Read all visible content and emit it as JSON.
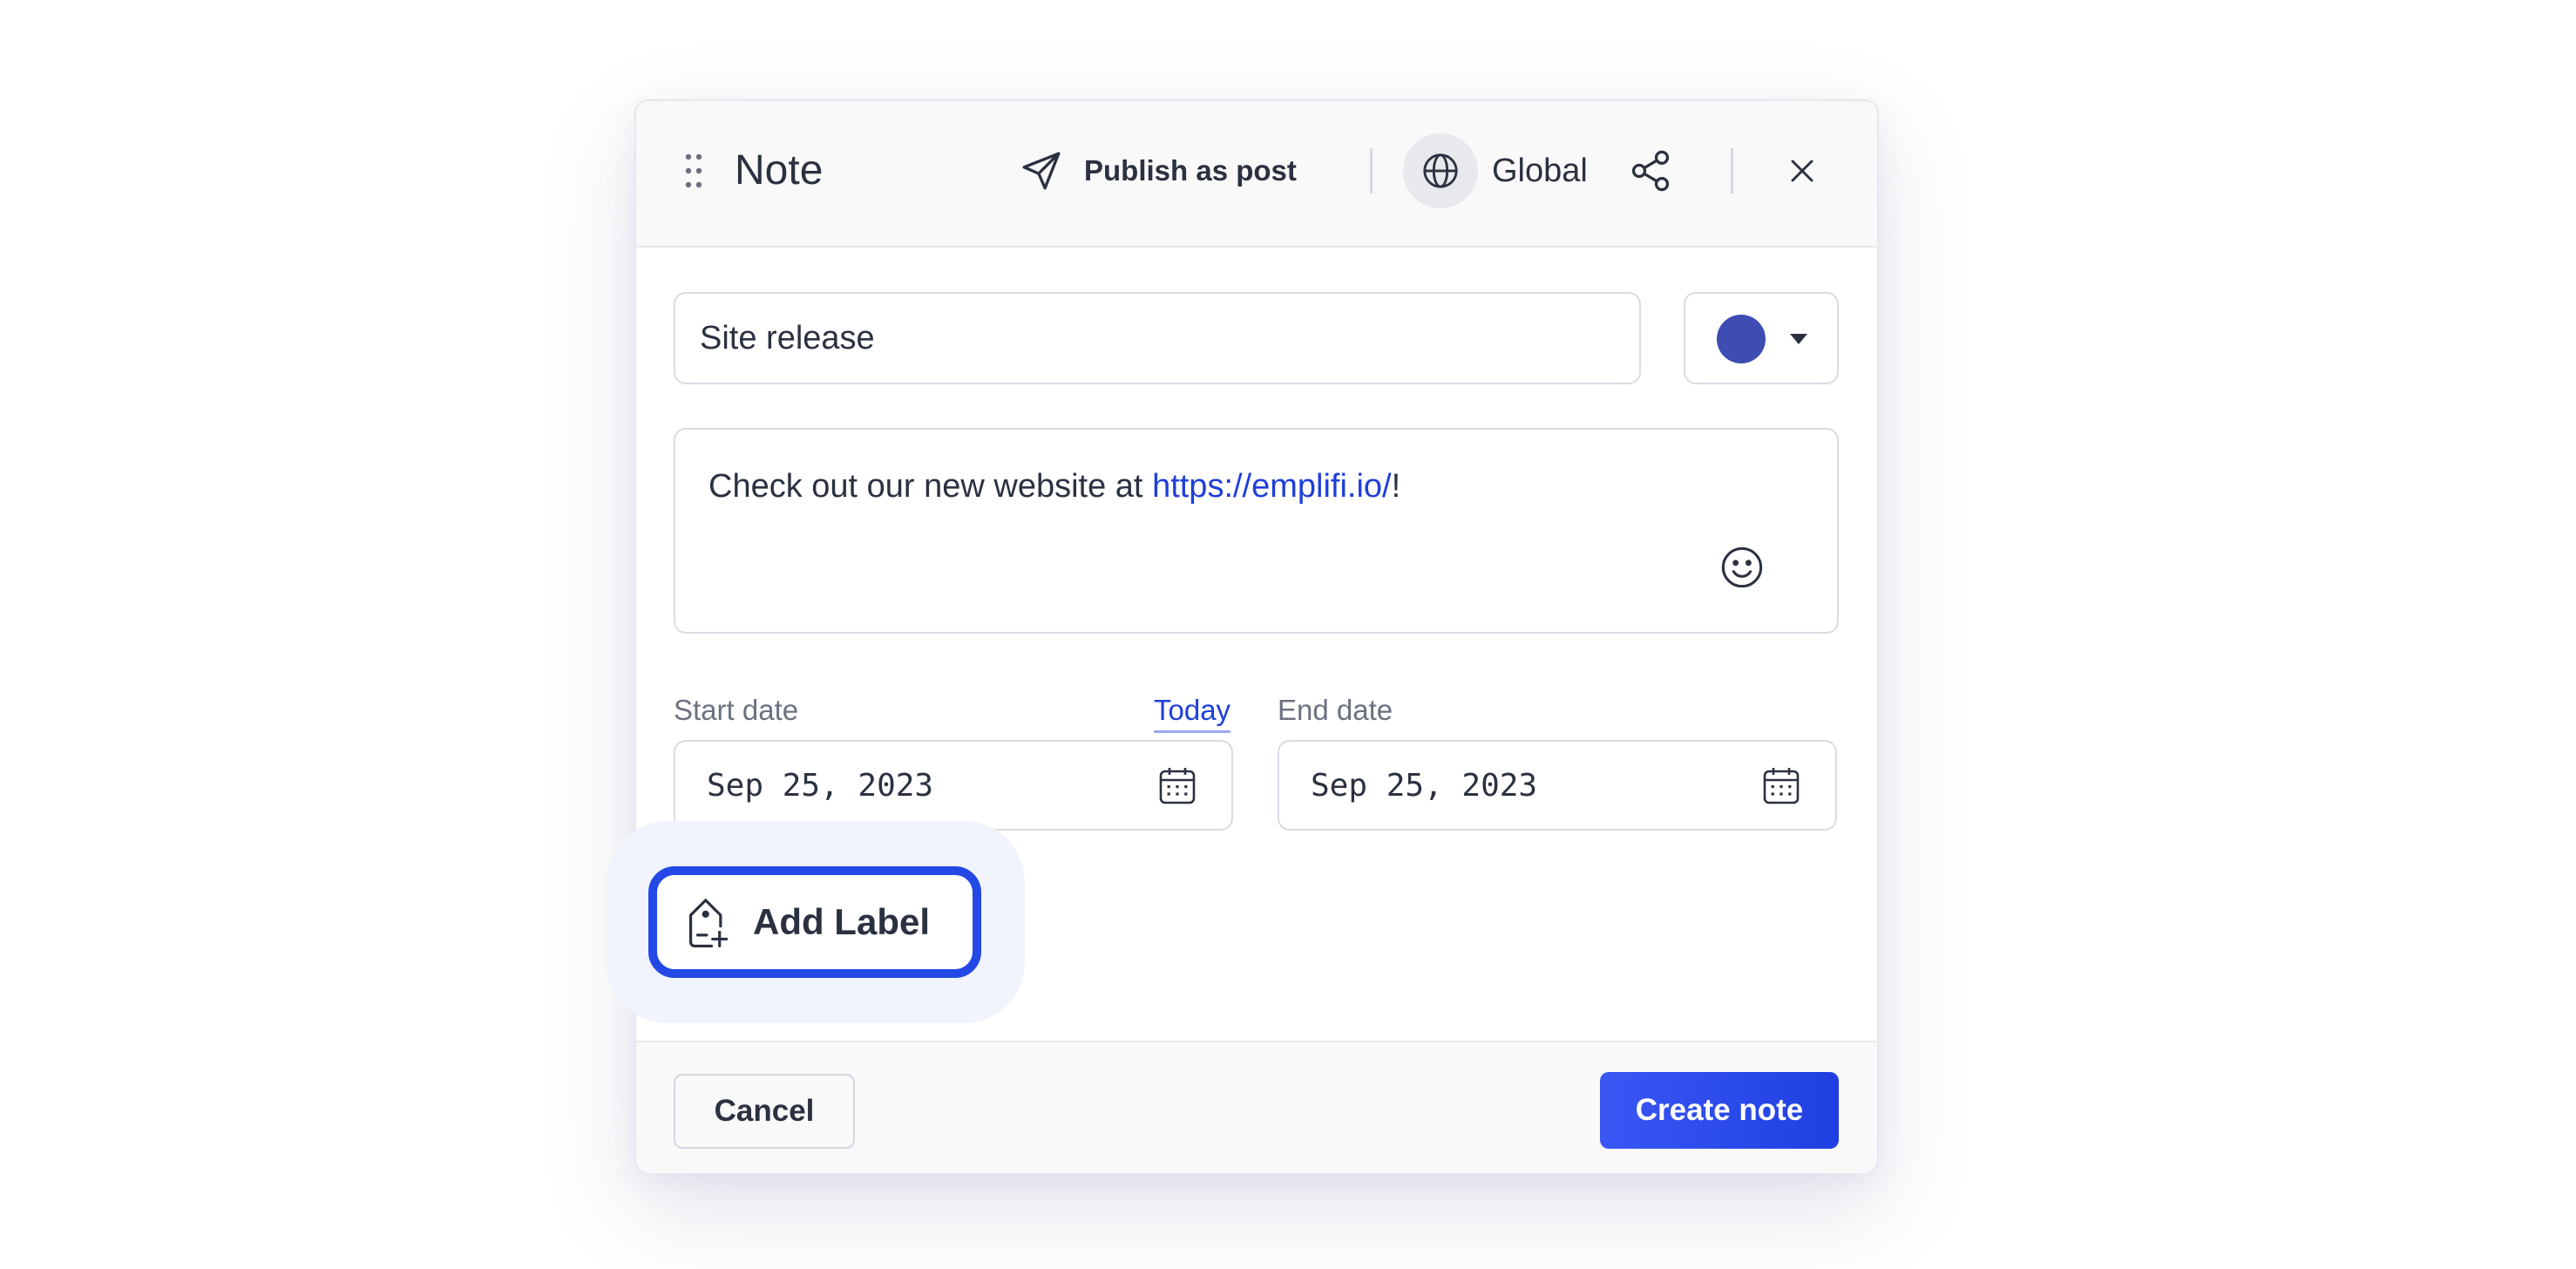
{
  "header": {
    "title": "Note",
    "publish_label": "Publish as post",
    "visibility_label": "Global"
  },
  "form": {
    "title_value": "Site release",
    "note_color": "#3e4db1",
    "message_prefix": "Check out our new website at ",
    "message_link": "https://emplifi.io/",
    "message_suffix": "!",
    "start_date_label": "Start date",
    "today_label": "Today",
    "start_date_value": "Sep 25, 2023",
    "end_date_label": "End date",
    "end_date_value": "Sep 25, 2023",
    "add_label": "Add Label"
  },
  "footer": {
    "cancel_label": "Cancel",
    "create_label": "Create note"
  },
  "colors": {
    "accent": "#2348e6",
    "link": "#1f3fd9"
  }
}
